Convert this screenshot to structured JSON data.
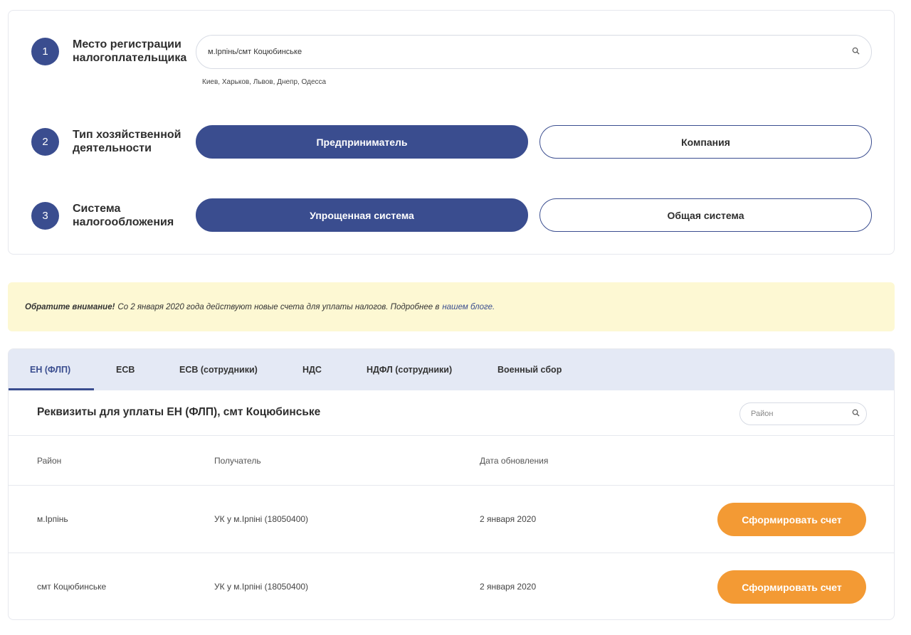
{
  "form": {
    "steps": [
      {
        "number": "1",
        "label": "Место регистрации налогоплательщика"
      },
      {
        "number": "2",
        "label": "Тип хозяйственной деятельности"
      },
      {
        "number": "3",
        "label": "Система налогообложения"
      }
    ],
    "location": {
      "value": "м.Ірпінь/смт Коцюбинське",
      "hint": "Киев, Харьков, Львов, Днепр, Одесса",
      "icon": "search-icon"
    },
    "activity_type": {
      "options": [
        "Предприниматель",
        "Компания"
      ],
      "selected": "Предприниматель"
    },
    "tax_system": {
      "options": [
        "Упрощенная система",
        "Общая система"
      ],
      "selected": "Упрощенная система"
    }
  },
  "notice": {
    "bold": "Обратите внимание!",
    "text": "Со 2 января 2020 года действуют новые счета для уплаты налогов. Подробнее в",
    "link": "нашем блоге."
  },
  "tabs": {
    "items": [
      "ЕН (ФЛП)",
      "ЕСВ",
      "ЕСВ (сотрудники)",
      "НДС",
      "НДФЛ (сотрудники)",
      "Военный сбор"
    ],
    "active": "ЕН (ФЛП)"
  },
  "panel": {
    "title": "Реквизиты для уплаты ЕН (ФЛП), смт Коцюбинське",
    "search_placeholder": "Район",
    "columns": [
      "Район",
      "Получатель",
      "Дата обновления"
    ],
    "rows": [
      {
        "district": "м.Ірпінь",
        "recipient": "УК у м.Ірпіні (18050400)",
        "date": "2 января 2020",
        "action": "Сформировать счет"
      },
      {
        "district": "смт Коцюбинське",
        "recipient": "УК у м.Ірпіні (18050400)",
        "date": "2 января 2020",
        "action": "Сформировать счет"
      }
    ]
  },
  "colors": {
    "primary": "#3a4d8f",
    "accent": "#f39a34",
    "notice_bg": "#fdf8d3",
    "tabbar_bg": "#e4e9f5"
  }
}
